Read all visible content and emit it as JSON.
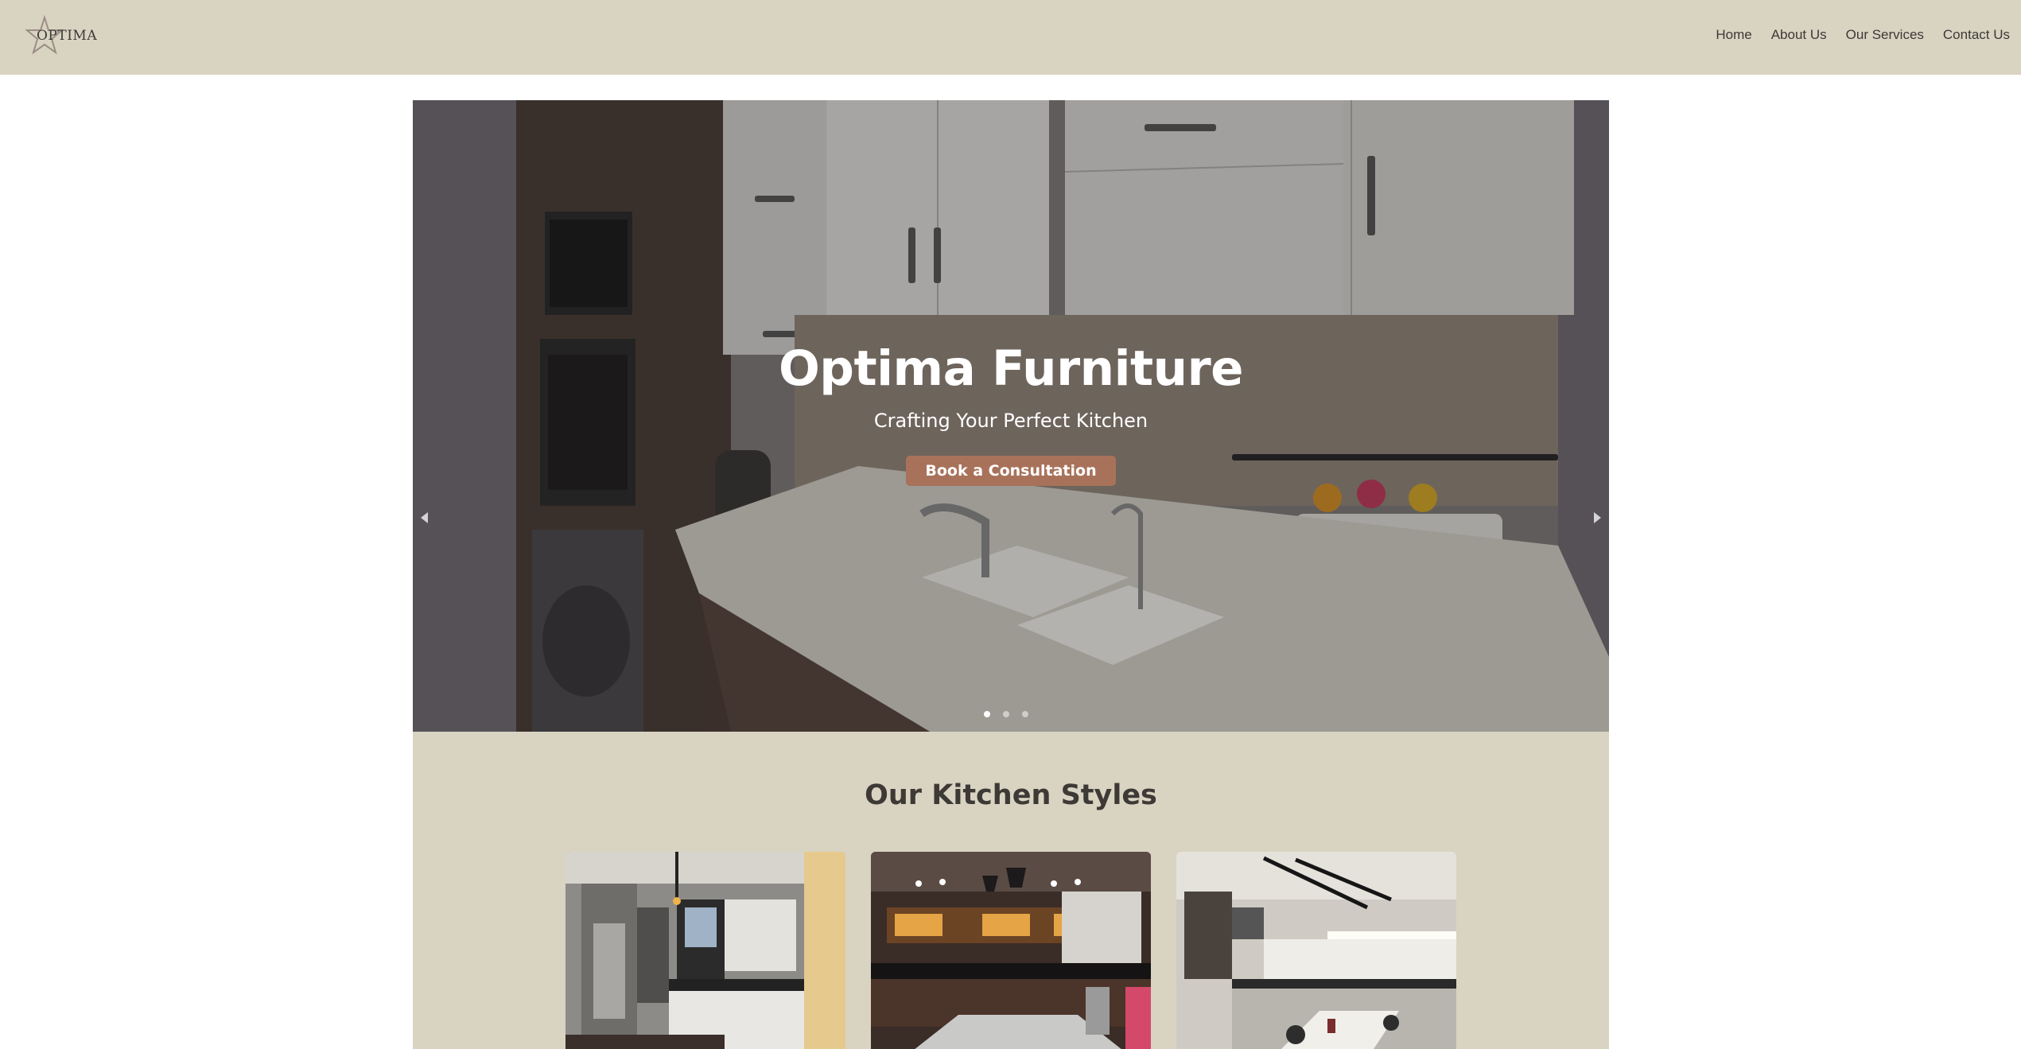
{
  "header": {
    "logo_text": "OPTIMA",
    "nav": [
      "Home",
      "About Us",
      "Our Services",
      "Contact Us"
    ]
  },
  "hero": {
    "title": "Optima Furniture",
    "subtitle": "Crafting Your Perfect Kitchen",
    "cta_label": "Book a Consultation",
    "slides_total": 3,
    "active_slide": 1
  },
  "kitchen_styles": {
    "title": "Our Kitchen Styles",
    "cards": [
      {
        "image": "modern-grey-kitchen-photo"
      },
      {
        "image": "dark-wood-kitchen-photo"
      },
      {
        "image": "white-kitchen-dining-photo"
      }
    ]
  },
  "icons": {
    "logo": "star-outline-logo",
    "prev": "chevron-left-icon",
    "next": "chevron-right-icon"
  },
  "colors": {
    "header_bg": "#d9d3c2",
    "section_bg": "#d9d3c2",
    "cta_bg": "#a8725a",
    "text_dark": "#3d3a36"
  }
}
